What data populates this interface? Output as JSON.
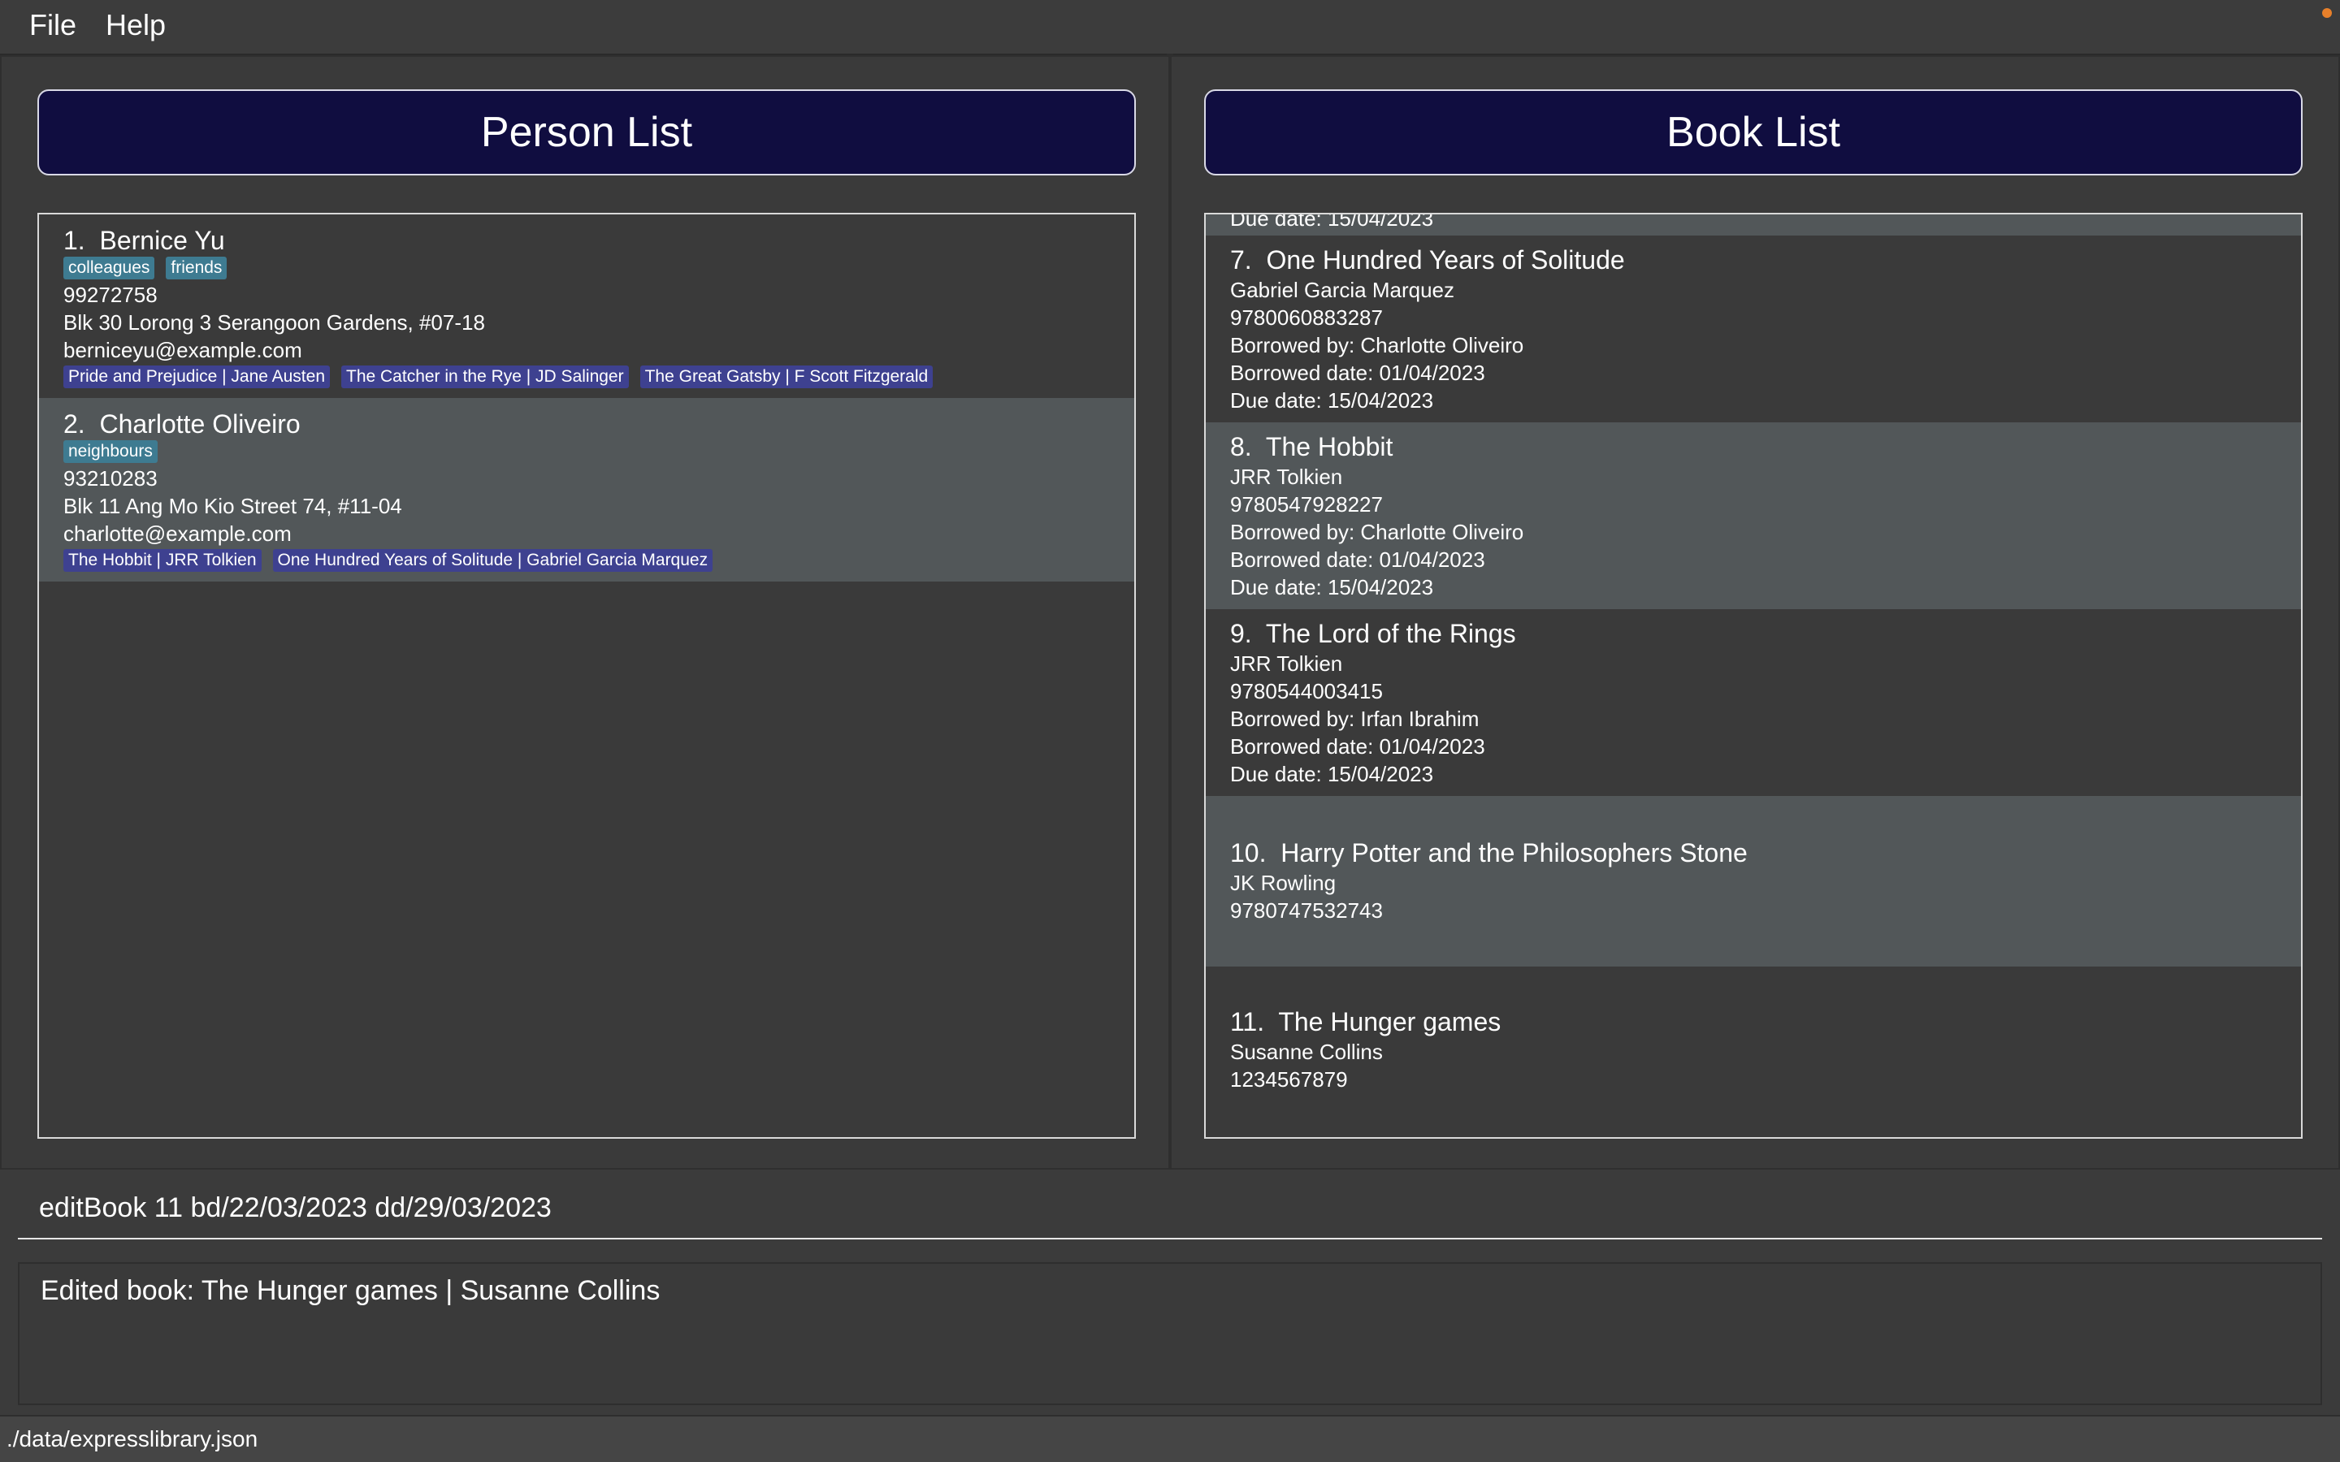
{
  "menu": {
    "file": "File",
    "help": "Help"
  },
  "colors": {
    "indicator": "#e8802a",
    "header_bg": "#100d40",
    "tag_teal": "#3e7b91",
    "tag_book": "#3e4190"
  },
  "person_panel": {
    "title": "Person List",
    "persons": [
      {
        "index": "1.",
        "name": "Bernice Yu",
        "tags": [
          "colleagues",
          "friends"
        ],
        "phone": "99272758",
        "address": "Blk 30 Lorong 3 Serangoon Gardens, #07-18",
        "email": "berniceyu@example.com",
        "books": [
          "Pride and Prejudice | Jane Austen",
          "The Catcher in the Rye | JD Salinger",
          "The Great Gatsby | F Scott Fitzgerald"
        ]
      },
      {
        "index": "2.",
        "name": "Charlotte Oliveiro",
        "tags": [
          "neighbours"
        ],
        "phone": "93210283",
        "address": "Blk 11 Ang Mo Kio Street 74, #11-04",
        "email": "charlotte@example.com",
        "books": [
          "The Hobbit | JRR Tolkien",
          "One Hundred Years of Solitude | Gabriel Garcia Marquez"
        ]
      }
    ]
  },
  "book_panel": {
    "title": "Book List",
    "partial_top": "Due date: 15/04/2023",
    "books": [
      {
        "index": "7.",
        "title": "One Hundred Years of Solitude",
        "author": "Gabriel Garcia Marquez",
        "isbn": "9780060883287",
        "borrowed_by": "Borrowed by: Charlotte Oliveiro",
        "borrowed_date": "Borrowed date: 01/04/2023",
        "due_date": "Due date: 15/04/2023"
      },
      {
        "index": "8.",
        "title": "The Hobbit",
        "author": "JRR Tolkien",
        "isbn": "9780547928227",
        "borrowed_by": "Borrowed by: Charlotte Oliveiro",
        "borrowed_date": "Borrowed date: 01/04/2023",
        "due_date": "Due date: 15/04/2023"
      },
      {
        "index": "9.",
        "title": "The Lord of the Rings",
        "author": "JRR Tolkien",
        "isbn": "9780544003415",
        "borrowed_by": "Borrowed by: Irfan Ibrahim",
        "borrowed_date": "Borrowed date: 01/04/2023",
        "due_date": "Due date: 15/04/2023"
      },
      {
        "index": "10.",
        "title": "Harry Potter and the Philosophers Stone",
        "author": "JK Rowling",
        "isbn": "9780747532743"
      },
      {
        "index": "11.",
        "title": "The Hunger games",
        "author": "Susanne Collins",
        "isbn": "1234567879"
      }
    ]
  },
  "command": {
    "value": "editBook 11 bd/22/03/2023 dd/29/03/2023"
  },
  "result": {
    "text": "Edited book: The Hunger games | Susanne Collins"
  },
  "status": {
    "file_path": "./data/expresslibrary.json"
  }
}
